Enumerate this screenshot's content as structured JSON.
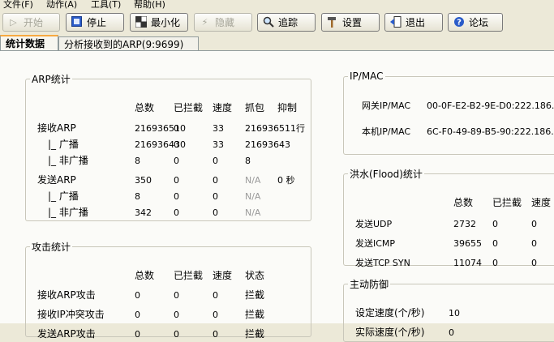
{
  "menu": [
    "文件(F)",
    "动作(A)",
    "工具(T)",
    "帮助(H)"
  ],
  "toolbar": {
    "start": "开始",
    "stop": "停止",
    "minimize": "最小化",
    "hide": "隐藏",
    "trace": "追踪",
    "settings": "设置",
    "exit": "退出",
    "forum": "论坛"
  },
  "tabs": {
    "stats": "统计数据",
    "analyze": "分析接收到的ARP(9:9699)"
  },
  "arp": {
    "title": "ARP统计",
    "headers": [
      "总数",
      "已拦截",
      "速度",
      "抓包",
      "抑制"
    ],
    "rows": [
      {
        "label": "接收ARP",
        "total": "216936510",
        "blocked": "0",
        "speed": "33",
        "capture": "216936511行",
        "suppress": ""
      },
      {
        "label": "|_ 广播",
        "total": "216936430",
        "blocked": "0",
        "speed": "33",
        "capture": "21693643",
        "suppress": ""
      },
      {
        "label": "|_ 非广播",
        "total": "8",
        "blocked": "0",
        "speed": "0",
        "capture": "8",
        "suppress": ""
      },
      {
        "label": "发送ARP",
        "total": "350",
        "blocked": "0",
        "speed": "0",
        "capture": "N/A",
        "suppress": "0 秒"
      },
      {
        "label": "|_ 广播",
        "total": "8",
        "blocked": "0",
        "speed": "0",
        "capture": "N/A",
        "suppress": ""
      },
      {
        "label": "|_ 非广播",
        "total": "342",
        "blocked": "0",
        "speed": "0",
        "capture": "N/A",
        "suppress": ""
      }
    ]
  },
  "attack": {
    "title": "攻击统计",
    "headers": [
      "总数",
      "已拦截",
      "速度",
      "状态"
    ],
    "rows": [
      {
        "label": "接收ARP攻击",
        "total": "0",
        "blocked": "0",
        "speed": "0",
        "status": "拦截"
      },
      {
        "label": "接收IP冲突攻击",
        "total": "0",
        "blocked": "0",
        "speed": "0",
        "status": "拦截"
      },
      {
        "label": "发送ARP攻击",
        "total": "0",
        "blocked": "0",
        "speed": "0",
        "status": "拦截"
      }
    ]
  },
  "ipmac": {
    "title": "IP/MAC",
    "gateway_label": "网关IP/MAC",
    "gateway_value": "00-0F-E2-B2-9E-D0:222.186.",
    "local_label": "本机IP/MAC",
    "local_value": "6C-F0-49-89-B5-90:222.186."
  },
  "flood": {
    "title": "洪水(Flood)统计",
    "headers": [
      "总数",
      "已拦截",
      "速度"
    ],
    "rows": [
      {
        "label": "发送UDP",
        "total": "2732",
        "blocked": "0",
        "speed": "0"
      },
      {
        "label": "发送ICMP",
        "total": "39655",
        "blocked": "0",
        "speed": "0"
      },
      {
        "label": "发送TCP SYN",
        "total": "11074",
        "blocked": "0",
        "speed": "0"
      }
    ]
  },
  "defense": {
    "title": "主动防御",
    "set_speed_label": "设定速度(个/秒)",
    "set_speed_value": "10",
    "actual_speed_label": "实际速度(个/秒)",
    "actual_speed_value": "0"
  }
}
